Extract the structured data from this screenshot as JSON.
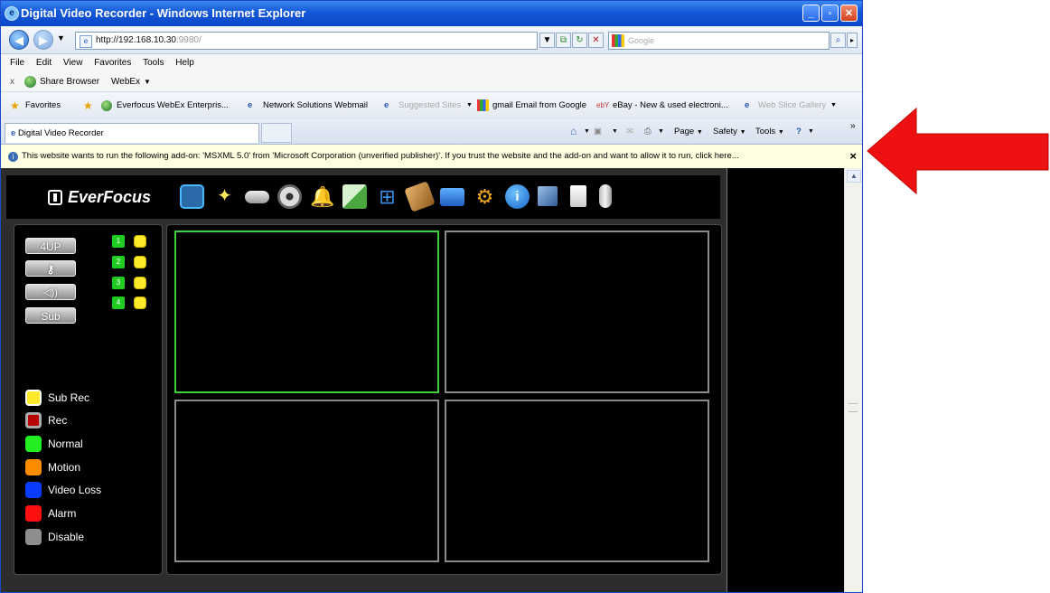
{
  "window": {
    "title": "Digital Video Recorder - Windows Internet Explorer"
  },
  "address": {
    "host": "http://192.168.10.30",
    "port": ":9980/"
  },
  "search": {
    "placeholder": "Google"
  },
  "menu": [
    "File",
    "Edit",
    "View",
    "Favorites",
    "Tools",
    "Help"
  ],
  "sharebar": {
    "close": "x",
    "share": "Share Browser",
    "webex": "WebEx"
  },
  "favorites": {
    "label": "Favorites",
    "items": [
      "Everfocus WebEx Enterpris...",
      "Network Solutions Webmail",
      "Suggested Sites",
      "gmail Email from Google",
      "eBay - New & used electroni...",
      "Web Slice Gallery"
    ]
  },
  "tab": {
    "label": "Digital Video Recorder"
  },
  "commandbar": {
    "page": "Page",
    "safety": "Safety",
    "tools": "Tools"
  },
  "infobar": {
    "text": "This website wants to run the following add-on: 'MSXML 5.0' from 'Microsoft Corporation (unverified publisher)'. If you trust the website and the add-on and want to allow it to run, click here...",
    "close": "×"
  },
  "dvr": {
    "brand": "EverFocus",
    "buttons": {
      "fourup": "4UP",
      "sub": "Sub"
    },
    "channels": [
      "1",
      "2",
      "3",
      "4"
    ],
    "legend": [
      "Sub Rec",
      "Rec",
      "Normal",
      "Motion",
      "Video Loss",
      "Alarm",
      "Disable"
    ],
    "legend_colors": [
      "#ffe92b",
      "#b80000",
      "#22ee22",
      "#ff8c00",
      "#0a3cff",
      "#ff1010",
      "#8e8e8e"
    ]
  }
}
